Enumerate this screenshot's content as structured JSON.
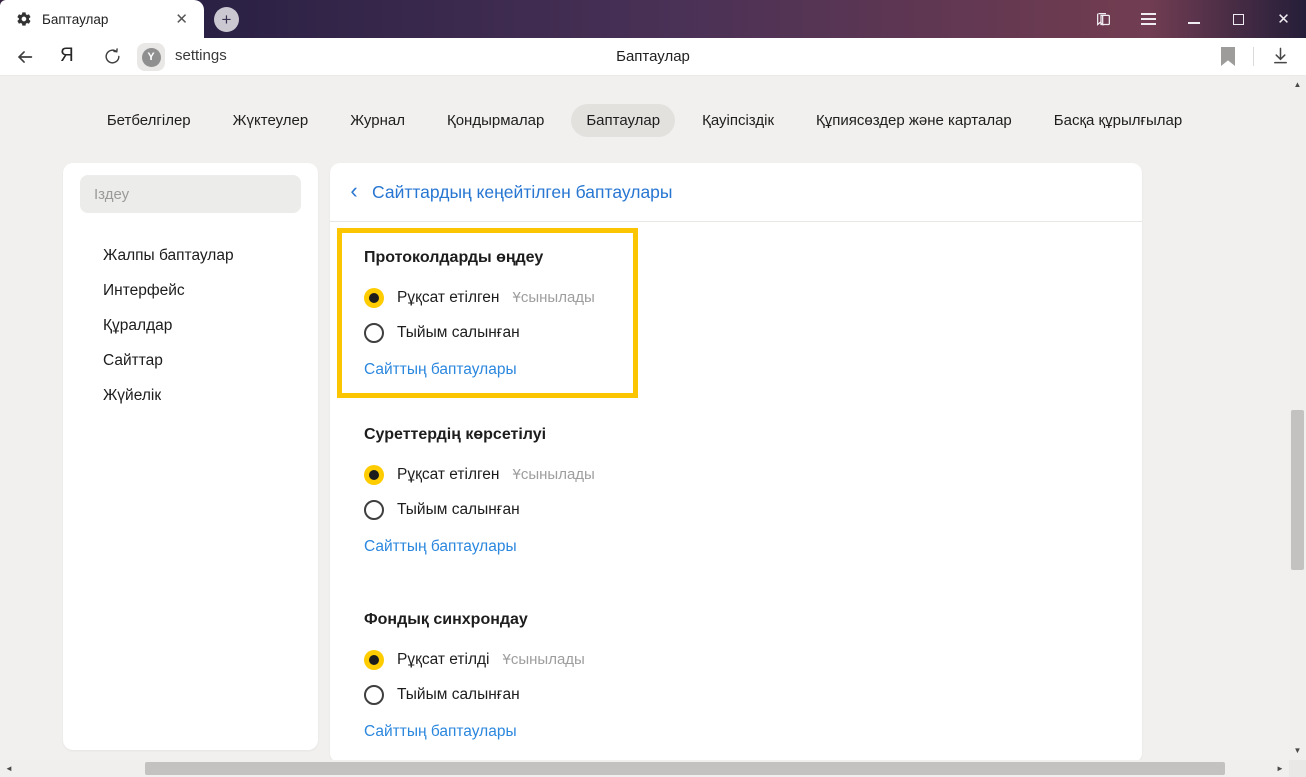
{
  "tabstrip": {
    "tab_title": "Баптаулар"
  },
  "toolbar": {
    "url": "settings",
    "page_title": "Баптаулар"
  },
  "nav": {
    "items": [
      "Бетбелгілер",
      "Жүктеулер",
      "Журнал",
      "Қондырмалар",
      "Баптаулар",
      "Қауіпсіздік",
      "Құпиясөздер және карталар",
      "Басқа құрылғылар"
    ],
    "selected": "Баптаулар"
  },
  "sidebar": {
    "search_placeholder": "Іздеу",
    "items": [
      "Жалпы баптаулар",
      "Интерфейс",
      "Құралдар",
      "Сайттар",
      "Жүйелік"
    ]
  },
  "content": {
    "back_title": "Сайттардың кеңейтілген баптаулары",
    "sections": [
      {
        "title": "Протоколдарды өңдеу",
        "highlighted": true,
        "options": [
          {
            "label": "Рұқсат етілген",
            "badge": "Ұсынылады",
            "selected": true
          },
          {
            "label": "Тыйым салынған",
            "selected": false
          }
        ],
        "link": "Сайттың баптаулары"
      },
      {
        "title": "Суреттердің көрсетілуі",
        "highlighted": false,
        "options": [
          {
            "label": "Рұқсат етілген",
            "badge": "Ұсынылады",
            "selected": true
          },
          {
            "label": "Тыйым салынған",
            "selected": false
          }
        ],
        "link": "Сайттың баптаулары"
      },
      {
        "title": "Фондық синхрондау",
        "highlighted": false,
        "options": [
          {
            "label": "Рұқсат етілді",
            "badge": "Ұсынылады",
            "selected": true
          },
          {
            "label": "Тыйым салынған",
            "selected": false
          }
        ],
        "link": "Сайттың баптаулары"
      }
    ]
  },
  "colors": {
    "highlight_yellow": "#fbc501",
    "radio_selected_yellow": "#ffcc00",
    "link_blue": "#2b87de",
    "header_blue": "#2776d2"
  }
}
